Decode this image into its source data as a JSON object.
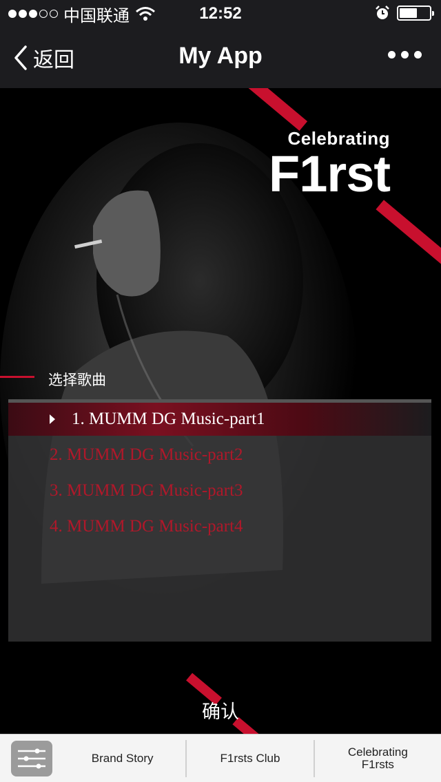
{
  "status_bar": {
    "carrier": "中国联通",
    "time": "12:52",
    "signal_icon": "signal-dots-icon",
    "wifi_icon": "wifi-icon",
    "alarm_icon": "alarm-icon",
    "battery_icon": "battery-icon",
    "battery_level": 0.6
  },
  "nav": {
    "back_label": "返回",
    "title": "My App",
    "more_icon": "more-dots-icon"
  },
  "hero": {
    "brand_sub": "Celebrating",
    "brand_main": "F1rst",
    "accent_color": "#c8102e"
  },
  "song_select": {
    "label": "选择歌曲",
    "tracks": [
      {
        "label": "1. MUMM DG Music-part1",
        "selected": true
      },
      {
        "label": "2. MUMM DG Music-part2",
        "selected": false
      },
      {
        "label": "3. MUMM DG Music-part3",
        "selected": false
      },
      {
        "label": "4. MUMM DG Music-part4",
        "selected": false
      }
    ],
    "confirm_label": "确认"
  },
  "tabbar": {
    "menu_icon": "sliders-menu-icon",
    "tabs": [
      {
        "label": "Brand Story"
      },
      {
        "label": "F1rsts Club"
      },
      {
        "label": "Celebrating\nF1rsts"
      }
    ]
  }
}
